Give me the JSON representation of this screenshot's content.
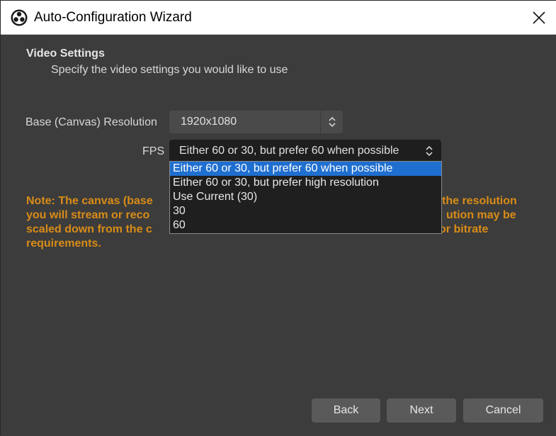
{
  "window": {
    "title": "Auto-Configuration Wizard",
    "app_icon": "obs-logo-icon",
    "close_icon": "close-icon"
  },
  "section": {
    "title": "Video Settings",
    "subtitle": "Specify the video settings you would like to use"
  },
  "form": {
    "resolution_label": "Base (Canvas) Resolution",
    "resolution_value": "1920x1080",
    "fps_label": "FPS",
    "fps_value": "Either 60 or 30, but prefer 60 when possible"
  },
  "dropdown": {
    "options": [
      "Either 60 or 30, but prefer 60 when possible",
      "Either 60 or 30, but prefer high resolution",
      "Use Current (30)",
      "30",
      "60"
    ],
    "selected_index": 0
  },
  "note": {
    "line1_visible": "Note: The canvas (base",
    "line1_right": "the resolution",
    "line2_visible": "you will stream or reco",
    "line2_right": "ution may be",
    "line3_visible": "scaled down from the c",
    "line3_right": "or bitrate",
    "line4": "requirements."
  },
  "buttons": {
    "back": "Back",
    "next": "Next",
    "cancel": "Cancel"
  },
  "colors": {
    "accent": "#1f6fd0",
    "note": "#d98c16",
    "background": "#3c3c3c"
  }
}
